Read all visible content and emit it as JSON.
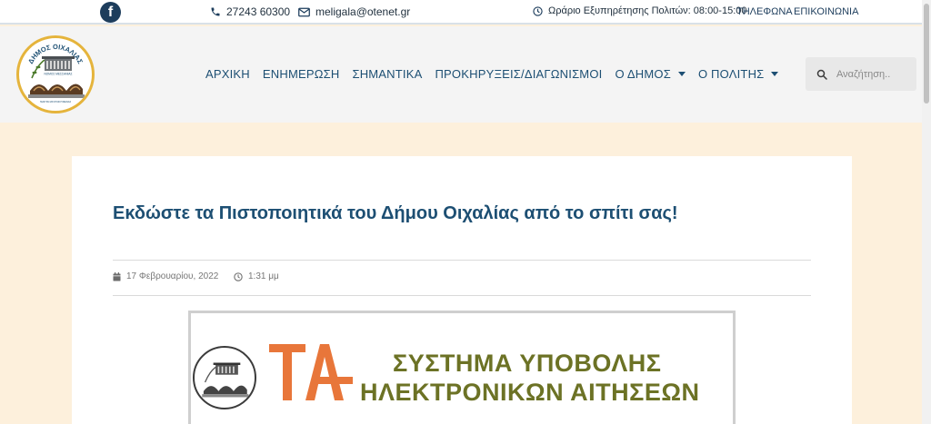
{
  "topbar": {
    "facebook_icon": "facebook-icon",
    "phone": "27243 60300",
    "email": "meligala@otenet.gr",
    "hours": "Ωράριο Εξυπηρέτησης Πολιτών: 08:00-15:00",
    "links": [
      "ΤΗΛΕΦΩΝΑ",
      "ΕΠΙΚΟΙΝΩΝΙΑ"
    ]
  },
  "header": {
    "logo": {
      "top_text": "ΔΗΜΟΣ ΟΙΧΑΛΙΑΣ",
      "sub_text": "ΝΟΜΟΣ ΜΕΣΣΗΝΙΑΣ",
      "bottom_text": "ΓΕΦΥΡΑ ΜΑΥΡΟΖΟΥΜΕΝΑΣ"
    },
    "nav": [
      {
        "label": "ΑΡΧΙΚΗ",
        "dropdown": false
      },
      {
        "label": "ΕΝΗΜΕΡΩΣΗ",
        "dropdown": false
      },
      {
        "label": "ΣΗΜΑΝΤΙΚΑ",
        "dropdown": false
      },
      {
        "label": "ΠΡΟΚΗΡΥΞΕΙΣ/ΔΙΑΓΩΝΙΣΜΟΙ",
        "dropdown": false
      },
      {
        "label": "Ο ΔΗΜΟΣ",
        "dropdown": true
      },
      {
        "label": "Ο ΠΟΛΙΤΗΣ",
        "dropdown": true
      }
    ],
    "search": {
      "placeholder": "Αναζήτηση..",
      "value": ""
    }
  },
  "article": {
    "title": "Εκδώστε τα Πιστοποιητικά του Δήμου Οιχαλίας από το σπίτι σας!",
    "date": "17 Φεβρουαρίου, 2022",
    "time": "1:31 μμ",
    "banner": {
      "mark": "ΤΑ",
      "line1": "ΣΥΣΤΗΜΑ ΥΠΟΒΟΛΗΣ",
      "line2": "ΗΛΕΚΤΡΟΝΙΚΩΝ ΑΙΤΗΣΕΩΝ"
    }
  },
  "colors": {
    "brand_navy": "#1d4f73",
    "page_bg": "#fdf0dc",
    "ta_orange": "#e8763a",
    "banner_olive": "#6c7225",
    "logo_gold": "#e5b43c"
  }
}
